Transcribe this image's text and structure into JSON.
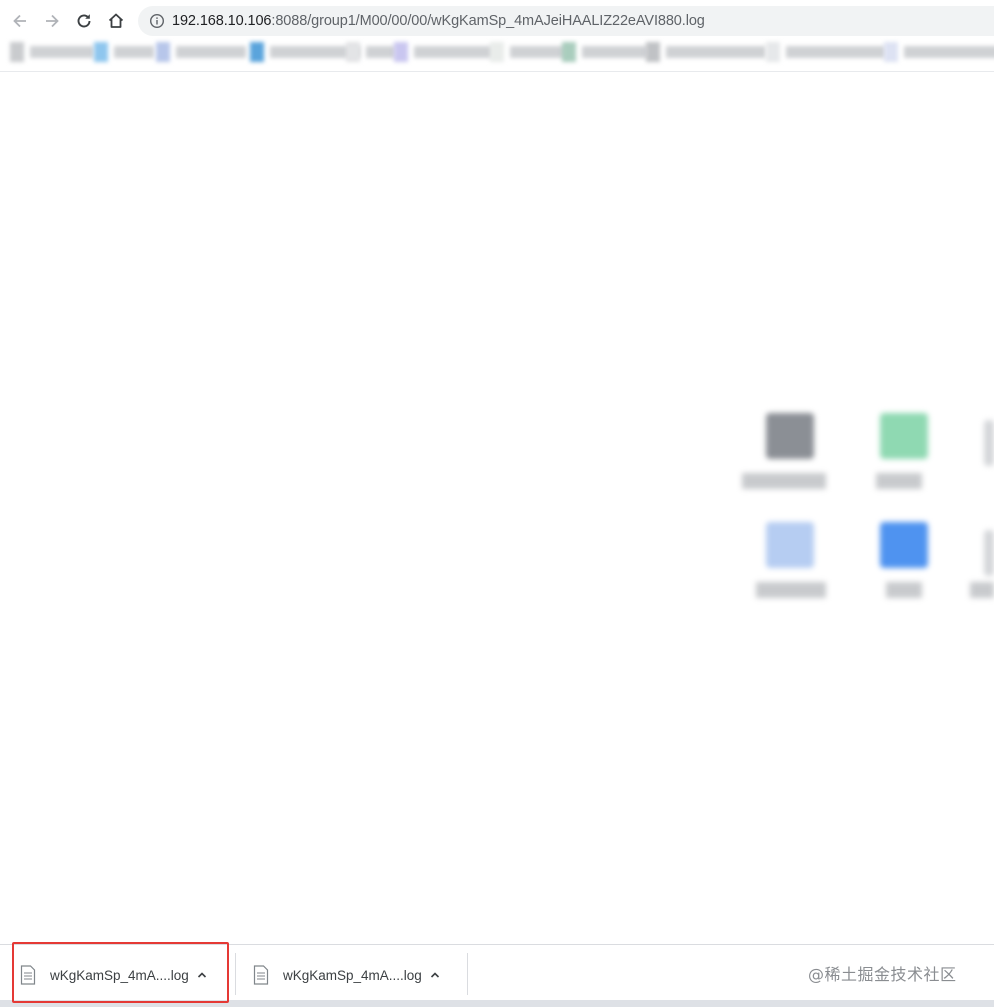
{
  "toolbar": {
    "back_icon": "arrow-left-icon",
    "forward_icon": "arrow-right-icon",
    "reload_icon": "reload-icon",
    "home_icon": "home-icon",
    "info_icon": "info-icon"
  },
  "address": {
    "host": "192.168.10.106",
    "rest": ":8088/group1/M00/00/00/wKgKamSp_4mAJeiHAALIZ22eAVI880.log"
  },
  "downloads": [
    {
      "name": "wKgKamSp_4mA....log",
      "icon": "file-icon"
    },
    {
      "name": "wKgKamSp_4mA....log",
      "icon": "file-icon"
    }
  ],
  "watermark": "@稀土掘金技术社区",
  "colors": {
    "highlight": "#e53935",
    "toolbar_bg": "#ffffff",
    "omnibox_bg": "#f1f3f4"
  }
}
